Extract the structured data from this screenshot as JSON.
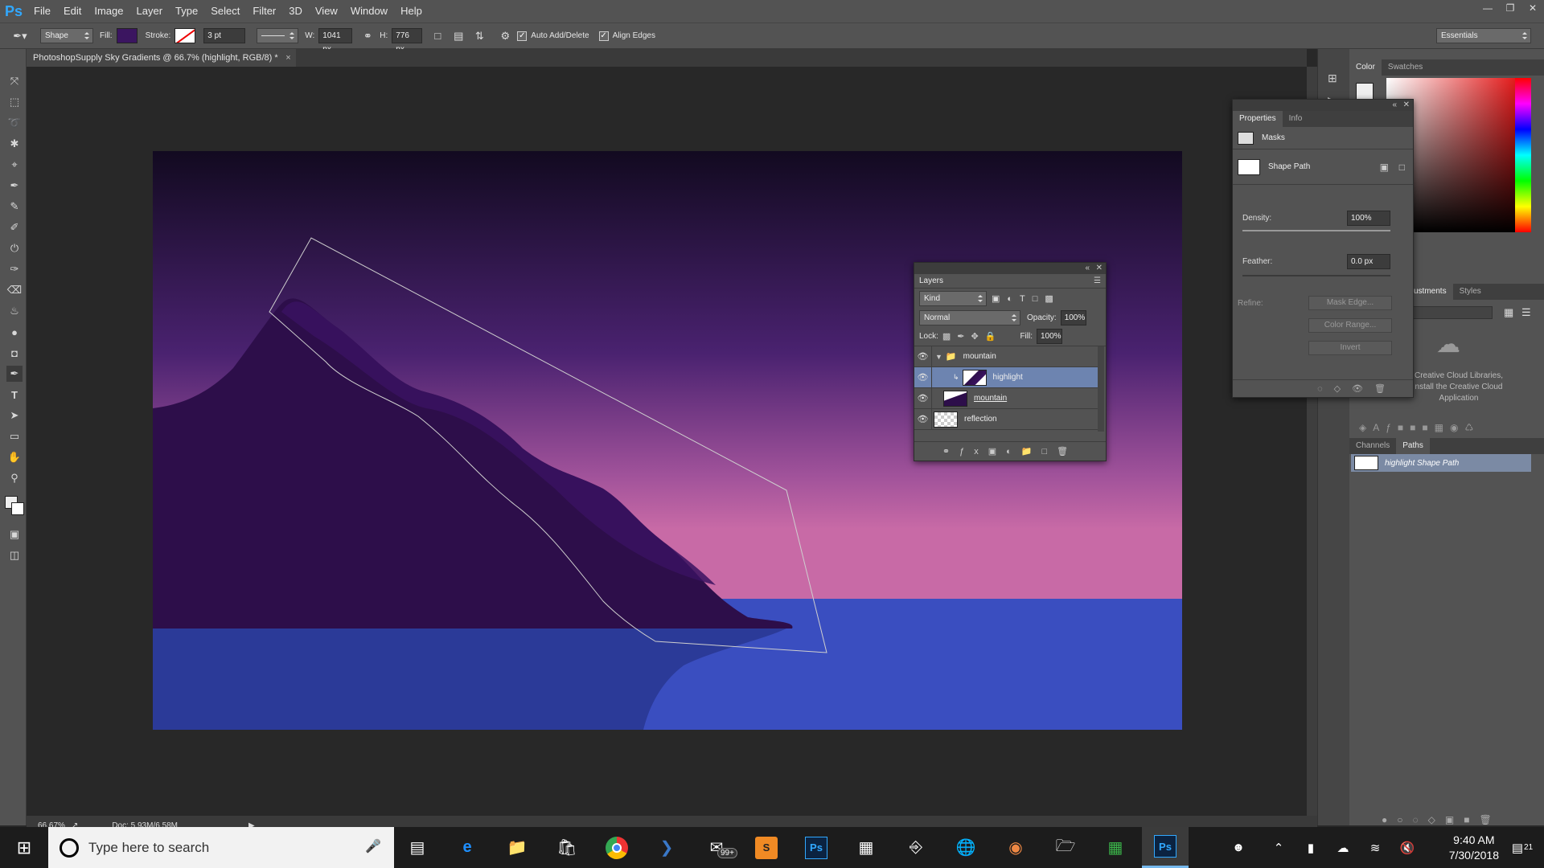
{
  "app": {
    "logo": "Ps"
  },
  "menu": [
    "File",
    "Edit",
    "Image",
    "Layer",
    "Type",
    "Select",
    "Filter",
    "3D",
    "View",
    "Window",
    "Help"
  ],
  "options_bar": {
    "mode": "Shape",
    "fill_label": "Fill:",
    "stroke_label": "Stroke:",
    "stroke_size": "3 pt",
    "w_label": "W:",
    "w_value": "1041 px",
    "h_label": "H:",
    "h_value": "776 px",
    "auto_add_delete": "Auto Add/Delete",
    "align_edges": "Align Edges",
    "workspace": "Essentials",
    "fill_color": "#3b1560"
  },
  "document": {
    "tab_title": "PhotoshopSupply Sky Gradients @ 66.7% (highlight, RGB/8) *",
    "close": "×",
    "colors": {
      "sky_top": "#120a20",
      "sky_mid": "#4a2270",
      "sky_low": "#c86aa6",
      "mountain": "#2d0e4a",
      "mountain_highlight": "#3a1260",
      "water": "#3a4ec0",
      "reflection": "#2b3a98"
    }
  },
  "status_bar": {
    "zoom": "66.67%",
    "doc": "Doc: 5.93M/6.58M"
  },
  "layers_panel": {
    "title": "Layers",
    "filter": "Kind",
    "blend_mode": "Normal",
    "opacity_label": "Opacity:",
    "opacity_value": "100%",
    "lock_label": "Lock:",
    "fill_label": "Fill:",
    "fill_value": "100%",
    "layers": [
      {
        "name": "mountain",
        "type": "group"
      },
      {
        "name": "highlight",
        "type": "shape",
        "selected": true
      },
      {
        "name": "mountain",
        "type": "shape"
      },
      {
        "name": "reflection",
        "type": "shape"
      }
    ]
  },
  "properties_panel": {
    "tabs": [
      "Properties",
      "Info"
    ],
    "section": "Masks",
    "shape_label": "Shape Path",
    "density_label": "Density:",
    "density_value": "100%",
    "density_fraction": 1.0,
    "feather_label": "Feather:",
    "feather_value": "0.0 px",
    "refine_label": "Refine:",
    "buttons": [
      "Mask Edge...",
      "Color Range...",
      "Invert"
    ]
  },
  "right_dock": {
    "color_tabs": [
      "Color",
      "Swatches"
    ],
    "lib_tabs": [
      "ustments",
      "Styles"
    ],
    "libraries_msg": [
      "Creative Cloud Libraries,",
      "nstall the Creative Cloud",
      "Application"
    ],
    "paths_tabs": [
      "Channels",
      "Paths"
    ],
    "path_item": "highlight Shape Path"
  },
  "taskbar": {
    "search_placeholder": "Type here to search",
    "mail_badge": "99+",
    "time": "9:40 AM",
    "date": "7/30/2018",
    "notifications": "21"
  }
}
